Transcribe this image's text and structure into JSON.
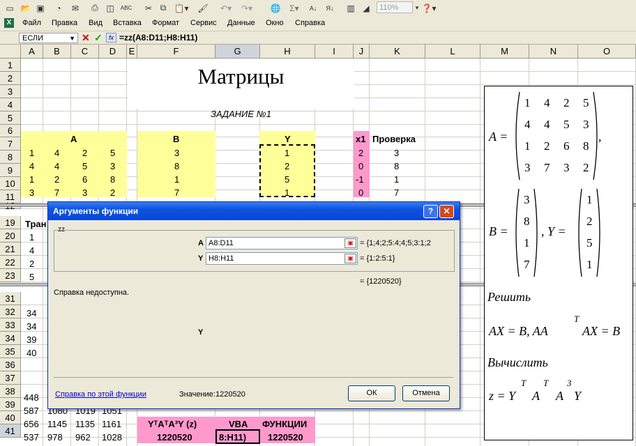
{
  "toolbar": {
    "icons": [
      "new-icon",
      "open-icon",
      "save-icon",
      "permission-icon",
      "email-icon",
      "print-icon",
      "print-preview-icon",
      "spelling-icon",
      "research-icon",
      "cut-icon",
      "copy-icon",
      "paste-icon",
      "format-painter-icon",
      "undo-icon",
      "redo-icon",
      "hyperlink-icon",
      "autosum-icon",
      "sort-ascending-icon",
      "sort-descending-icon",
      "chart-wizard-icon",
      "drawing-icon",
      "help-icon"
    ],
    "zoom": "110%"
  },
  "menu": {
    "items": [
      "Файл",
      "Правка",
      "Вид",
      "Вставка",
      "Формат",
      "Сервис",
      "Данные",
      "Окно",
      "Справка"
    ]
  },
  "formula_bar": {
    "name_box": "ЕСЛИ",
    "formula": "=zz(A8:D11;H8:H11)",
    "fx": "fx"
  },
  "columns": [
    "A",
    "B",
    "C",
    "D",
    "E",
    "F",
    "G",
    "H",
    "I",
    "J",
    "K",
    "L",
    "M",
    "N",
    "O"
  ],
  "rows_visible": [
    "1",
    "2",
    "3",
    "4",
    "5",
    "6",
    "7",
    "8",
    "9",
    "10",
    "11",
    "12",
    "19",
    "20",
    "21",
    "22",
    "23",
    "31",
    "32",
    "33",
    "34",
    "35",
    "36",
    "37",
    "38",
    "39",
    "40",
    "41"
  ],
  "sheet": {
    "title": "Матрицы",
    "task": "ЗАДАНИЕ №1",
    "label_A": "A",
    "label_B": "B",
    "label_Y": "Y",
    "label_x1": "x1",
    "label_check": "Проверка",
    "matrix_A": [
      [
        "1",
        "4",
        "2",
        "5"
      ],
      [
        "4",
        "4",
        "5",
        "3"
      ],
      [
        "1",
        "2",
        "6",
        "8"
      ],
      [
        "3",
        "7",
        "3",
        "2"
      ]
    ],
    "vector_B": [
      "3",
      "8",
      "1",
      "7"
    ],
    "vector_Y": [
      "1",
      "2",
      "5",
      "1"
    ],
    "x1": [
      "2",
      "0",
      "-1",
      "0"
    ],
    "check": [
      "3",
      "8",
      "1",
      "7"
    ],
    "trans_label": "Тран",
    "col_a_19_23": [
      "1",
      "4",
      "2",
      "5"
    ],
    "col_a_32_35": [
      "34",
      "34",
      "39",
      "40"
    ],
    "row38": [
      "448",
      "",
      "",
      ""
    ],
    "row39": [
      "587",
      "1080",
      "1019",
      "1051"
    ],
    "row40": [
      "656",
      "1145",
      "1135",
      "1161"
    ],
    "row41": [
      "537",
      "978",
      "962",
      "1028"
    ],
    "result_label_1": "YᵀAᵀA³Y   (z)",
    "result_label_2": "VBA",
    "result_label_3": "ФУНКЦИИ",
    "result_1": "1220520",
    "result_2": "8:H11)",
    "result_3": "1220520"
  },
  "panel": {
    "a_label": "A  =",
    "A_rows": [
      [
        "1",
        "4",
        "2",
        "5"
      ],
      [
        "4",
        "4",
        "5",
        "3"
      ],
      [
        "1",
        "2",
        "6",
        "8"
      ],
      [
        "3",
        "7",
        "3",
        "2"
      ]
    ],
    "b_label": "B  =",
    "B_vals": [
      "3",
      "8",
      "1",
      "7"
    ],
    "y_label": ", Y  =",
    "Y_vals": [
      "1",
      "2",
      "5",
      "1"
    ],
    "solve": "Решить",
    "eq": "AX  =  B,   AA",
    "eq_sup": "T",
    "eq2": "AX  =  B",
    "compute": "Вычислить",
    "z_eq": "z  =  Y",
    "z_t1": "T",
    "z_a1": "A",
    "z_t2": "T",
    "z_a2": "A",
    "z_3": "3",
    "z_y": "Y",
    "comma": ","
  },
  "dialog": {
    "title": "Аргументы функции",
    "group": "zz",
    "arg1_label": "A",
    "arg1_value": "A8:D11",
    "arg1_result": "= {1;4;2;5:4;4;5;3:1;2",
    "arg2_label": "Y",
    "arg2_value": "H8:H11",
    "arg2_result": "= {1:2:5:1}",
    "total": "= {1220520}",
    "help_na": "Справка недоступна.",
    "arg_desc": "Y",
    "help_link": "Справка по этой функции",
    "value_label": "Значение:",
    "value": "1220520",
    "ok": "ОК",
    "cancel": "Отмена"
  }
}
